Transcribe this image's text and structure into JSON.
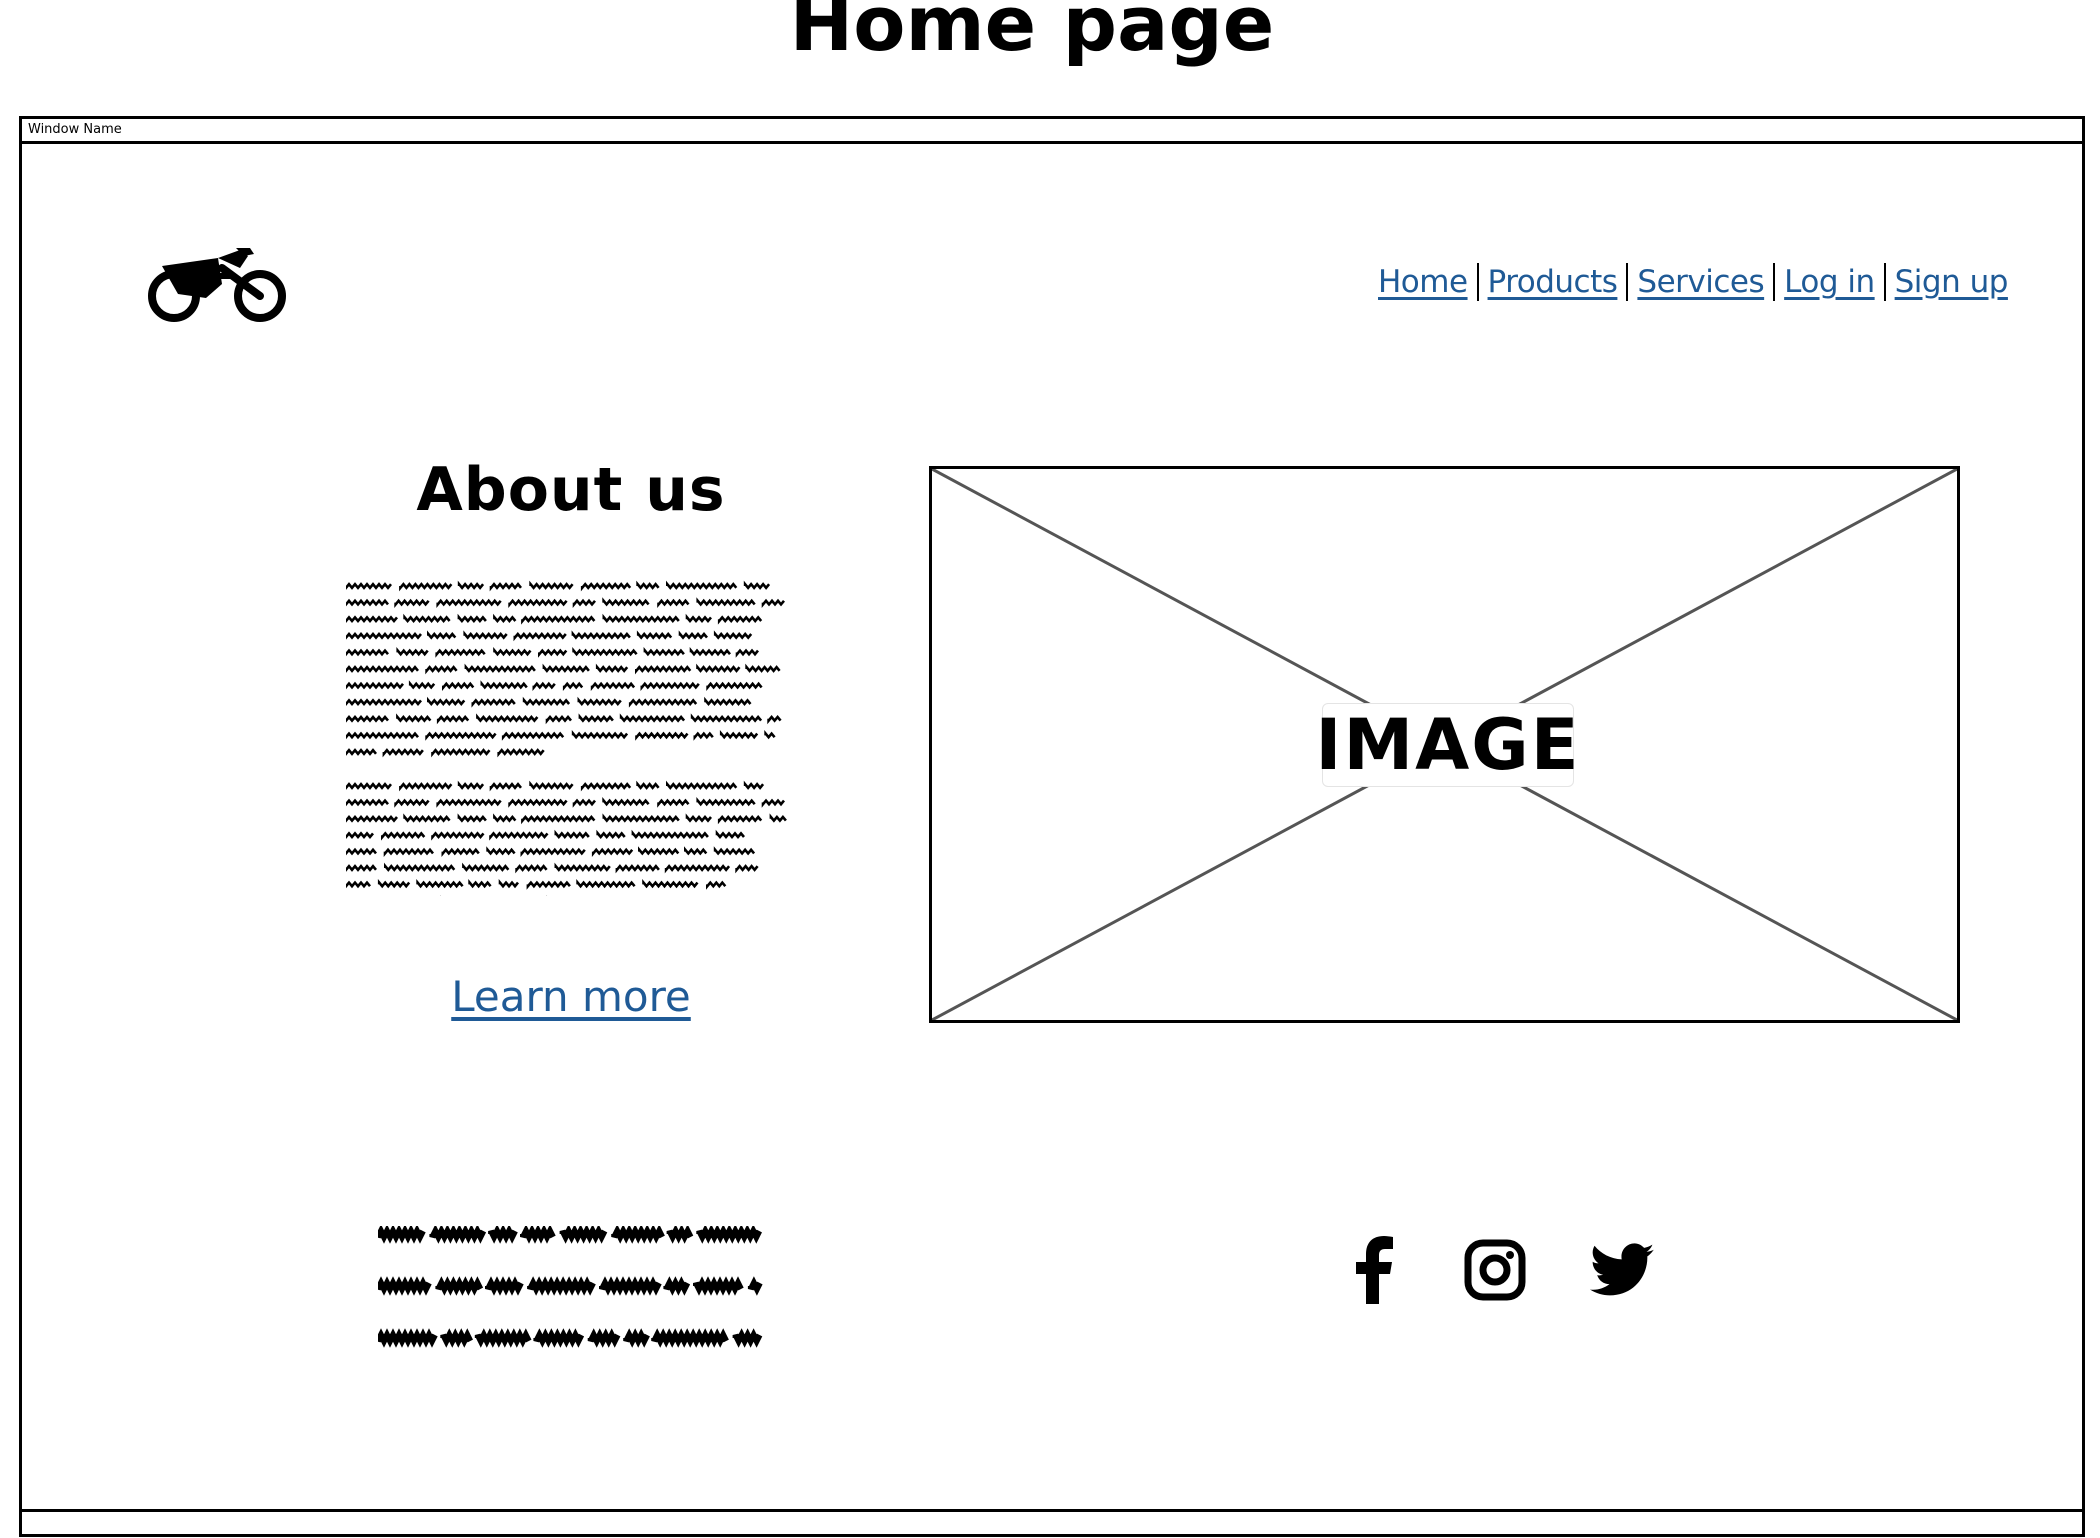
{
  "page_title": "Home page",
  "window": {
    "name": "Window Name"
  },
  "logo": {
    "icon": "motorcycle-icon"
  },
  "nav": {
    "color": "#1f5a96",
    "items": [
      {
        "label": "Home"
      },
      {
        "label": "Products"
      },
      {
        "label": "Services"
      },
      {
        "label": "Log in"
      },
      {
        "label": "Sign up"
      }
    ]
  },
  "about": {
    "title": "About us",
    "learn_more_label": "Learn more"
  },
  "image_placeholder": {
    "label": "IMAGE"
  },
  "social": {
    "icons": [
      "facebook-icon",
      "instagram-icon",
      "twitter-icon"
    ]
  }
}
